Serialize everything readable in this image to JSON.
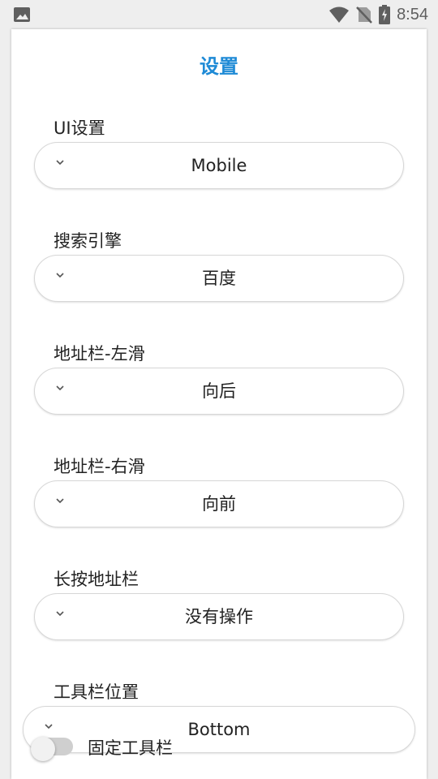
{
  "status_bar": {
    "time": "8:54",
    "icons": [
      "image-icon",
      "wifi-icon",
      "no-sim-icon",
      "battery-charging-icon"
    ]
  },
  "dialog": {
    "title": "设置",
    "settings": [
      {
        "label": "UI设置",
        "value": "Mobile"
      },
      {
        "label": "搜索引擎",
        "value": "百度"
      },
      {
        "label": "地址栏-左滑",
        "value": "向后"
      },
      {
        "label": "地址栏-右滑",
        "value": "向前"
      },
      {
        "label": "长按地址栏",
        "value": "没有操作"
      },
      {
        "label": "工具栏位置",
        "value": "Bottom"
      }
    ],
    "toggle": {
      "label": "固定工具栏",
      "checked": false
    }
  },
  "colors": {
    "accent": "#1e8ad6"
  }
}
